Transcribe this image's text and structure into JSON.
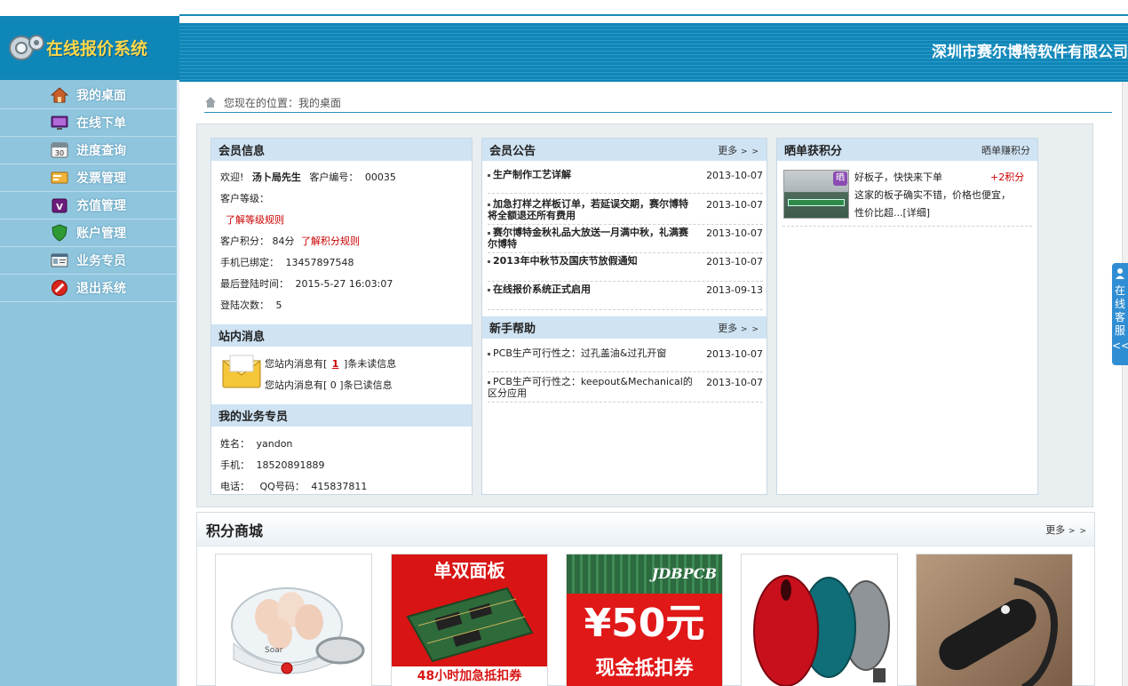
{
  "app": {
    "logo_text": "在线报价系统",
    "company": "深圳市赛尔博特软件有限公司"
  },
  "sidebar": {
    "items": [
      {
        "label": "我的桌面",
        "icon": "home-icon"
      },
      {
        "label": "在线下单",
        "icon": "monitor-icon"
      },
      {
        "label": "进度查询",
        "icon": "calendar-icon"
      },
      {
        "label": "发票管理",
        "icon": "invoice-icon"
      },
      {
        "label": "充值管理",
        "icon": "recharge-icon"
      },
      {
        "label": "账户管理",
        "icon": "shield-icon"
      },
      {
        "label": "业务专员",
        "icon": "id-card-icon"
      },
      {
        "label": "退出系统",
        "icon": "exit-icon"
      }
    ]
  },
  "breadcrumb": {
    "text": "您现在的位置：我的桌面"
  },
  "member": {
    "title": "会员信息",
    "welcome": "欢迎!",
    "name": "汤卜局先生",
    "id_label": "客户编号：",
    "id_value": "00035",
    "level_label": "客户等级：",
    "level_link": "了解等级规则",
    "points_label": "客户积分：",
    "points_value": "84分",
    "points_link": "了解积分规则",
    "phone_label": "手机已绑定：",
    "phone_value": "13457897548",
    "last_login_label": "最后登陆时间：",
    "last_login_value": "2015-5-27 16:03:07",
    "login_count_label": "登陆次数：",
    "login_count_value": "5"
  },
  "messages": {
    "title": "站内消息",
    "unread_prefix": "您站内消息有[",
    "unread_count": "1",
    "unread_suffix": "]条未读信息",
    "read_text": "您站内消息有[ 0 ]条已读信息"
  },
  "agent": {
    "title": "我的业务专员",
    "name_label": "姓名：",
    "name_value": "yandon",
    "mobile_label": "手机：",
    "mobile_value": "18520891889",
    "phone_label": "电话：",
    "qq_label": "QQ号码：",
    "qq_value": "415837811"
  },
  "notice": {
    "title": "会员公告",
    "more": "更多",
    "items": [
      {
        "title": "生产制作工艺详解",
        "date": "2013-10-07"
      },
      {
        "title": "加急打样之样板订单，若延误交期，赛尔博特将全额退还所有费用",
        "date": "2013-10-07"
      },
      {
        "title": "赛尔博特金秋礼品大放送一月满中秋，礼满赛尔博特",
        "date": "2013-10-07"
      },
      {
        "title": "2013年中秋节及国庆节放假通知",
        "date": "2013-10-07"
      },
      {
        "title": "在线报价系统正式启用",
        "date": "2013-09-13"
      }
    ]
  },
  "help": {
    "title": "新手帮助",
    "more": "更多",
    "items": [
      {
        "title": "PCB生产可行性之：过孔盖油&过孔开窗",
        "date": "2013-10-07"
      },
      {
        "title": "PCB生产可行性之：keepout&Mechanical的区分应用",
        "date": "2013-10-07"
      }
    ]
  },
  "showcase": {
    "title": "晒单获积分",
    "link": "晒单赚积分",
    "badge": "晒",
    "post_title": "好板子，快快来下单",
    "post_points": "+2积分",
    "post_body": "这家的板子确实不错，价格也便宜，性价比超...",
    "post_detail": "[详细]"
  },
  "shop": {
    "title": "积分商城",
    "more": "更多",
    "products": [
      {
        "name": "egg-cooker",
        "brand": "Soar"
      },
      {
        "name": "single-double-board-voucher",
        "banner": "单双面板",
        "footer": "48小时加急抵扣券"
      },
      {
        "name": "cash-voucher",
        "brand": "JDBPCB",
        "amount": "¥50元",
        "footer": "现金抵扣券"
      },
      {
        "name": "wireless-mouse"
      },
      {
        "name": "bluetooth-headset"
      }
    ]
  },
  "service_tab": {
    "text": "在线客服",
    "arrow": "<<"
  },
  "colors": {
    "banner": "#0f86b8",
    "sidebar": "#8fc6de",
    "box_head": "#cfe3f3",
    "link_red": "#cc0000",
    "logo_yellow": "#ffd84a"
  }
}
